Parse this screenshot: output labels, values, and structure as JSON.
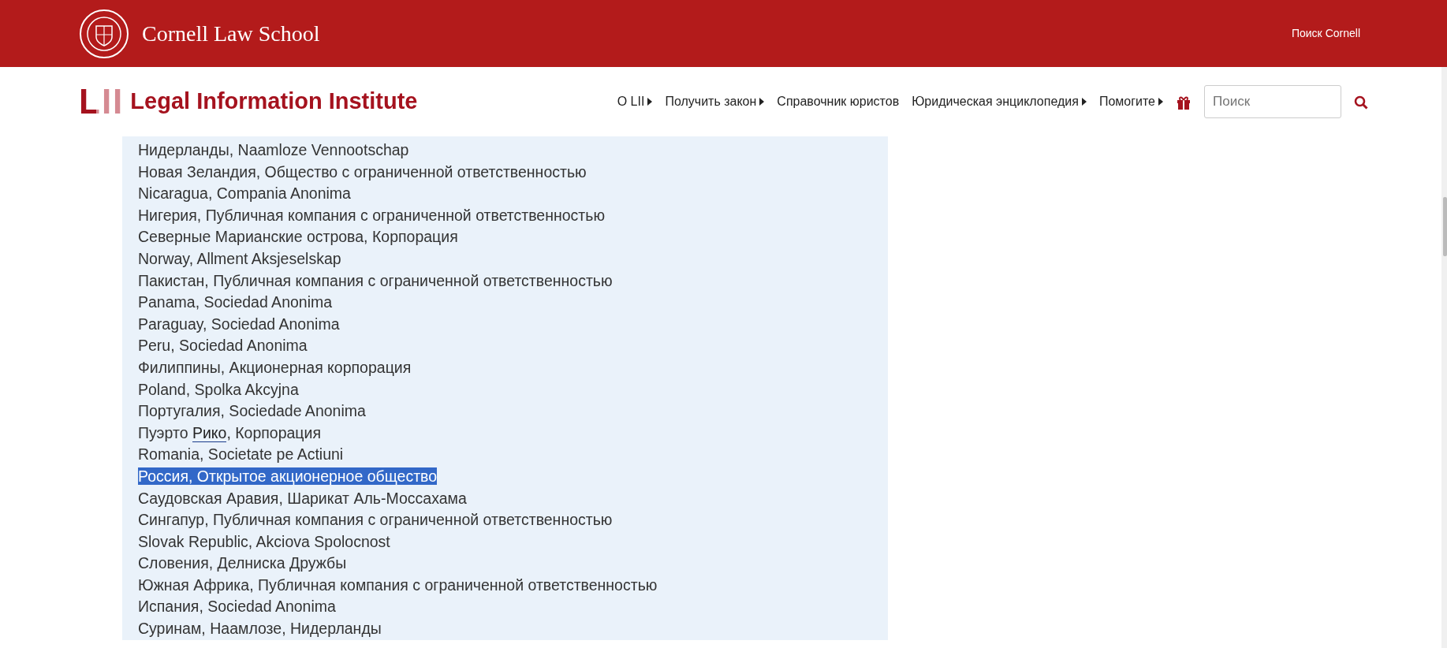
{
  "top_bar": {
    "title": "Cornell Law School",
    "search_link": "Поиск Cornell"
  },
  "site_header": {
    "logo_mark": "LII",
    "logo_text": "Legal Information Institute",
    "nav": [
      {
        "label": "О LII",
        "has_menu": true
      },
      {
        "label": "Получить закон",
        "has_menu": true
      },
      {
        "label": "Справочник юристов",
        "has_menu": false
      },
      {
        "label": "Юридическая энциклопедия",
        "has_menu": true
      },
      {
        "label": "Помогите",
        "has_menu": true
      }
    ],
    "search": {
      "placeholder": "Поиск"
    }
  },
  "list": [
    {
      "text": "Нидерланды, Naamloze Vennootschap",
      "selected": false
    },
    {
      "text": "Новая Зеландия, Общество с ограниченной ответственностью",
      "selected": false
    },
    {
      "text": "Nicaragua, Compania Anonima",
      "selected": false
    },
    {
      "text": "Нигерия, Публичная компания с ограниченной ответственностью",
      "selected": false
    },
    {
      "text": "Северные Марианские острова, Корпорация",
      "selected": false
    },
    {
      "text": "Norway, Allment Aksjeselskap",
      "selected": false
    },
    {
      "text": "Пакистан, Публичная компания с ограниченной ответственностью",
      "selected": false
    },
    {
      "text": "Panama, Sociedad Anonima",
      "selected": false
    },
    {
      "text": "Paraguay, Sociedad Anonima",
      "selected": false
    },
    {
      "text": "Peru, Sociedad Anonima",
      "selected": false
    },
    {
      "text": "Филиппины, Акционерная корпорация",
      "selected": false
    },
    {
      "text": "Poland, Spolka Akcyjna",
      "selected": false
    },
    {
      "text": "Португалия, Sociedade Anonima",
      "selected": false
    },
    {
      "text": "Пуэрто ",
      "link": "Рико",
      "after": ", Корпорация",
      "selected": false
    },
    {
      "text": "Romania, Societate pe Actiuni",
      "selected": false
    },
    {
      "text": "Россия, Открытое акционерное общество",
      "selected": true
    },
    {
      "text": "Саудовская Аравия, Шарикат Аль-Моссахама",
      "selected": false
    },
    {
      "text": "Сингапур, Публичная компания с ограниченной ответственностью",
      "selected": false
    },
    {
      "text": "Slovak Republic, Akciova Spolocnost",
      "selected": false
    },
    {
      "text": "Словения, Делниска Дружбы",
      "selected": false
    },
    {
      "text": "Южная Африка, Публичная компания с ограниченной ответственностью",
      "selected": false
    },
    {
      "text": "Испания, Sociedad Anonima",
      "selected": false
    },
    {
      "text": "Суринам, Наамлозе, Нидерланды",
      "selected": false
    }
  ]
}
